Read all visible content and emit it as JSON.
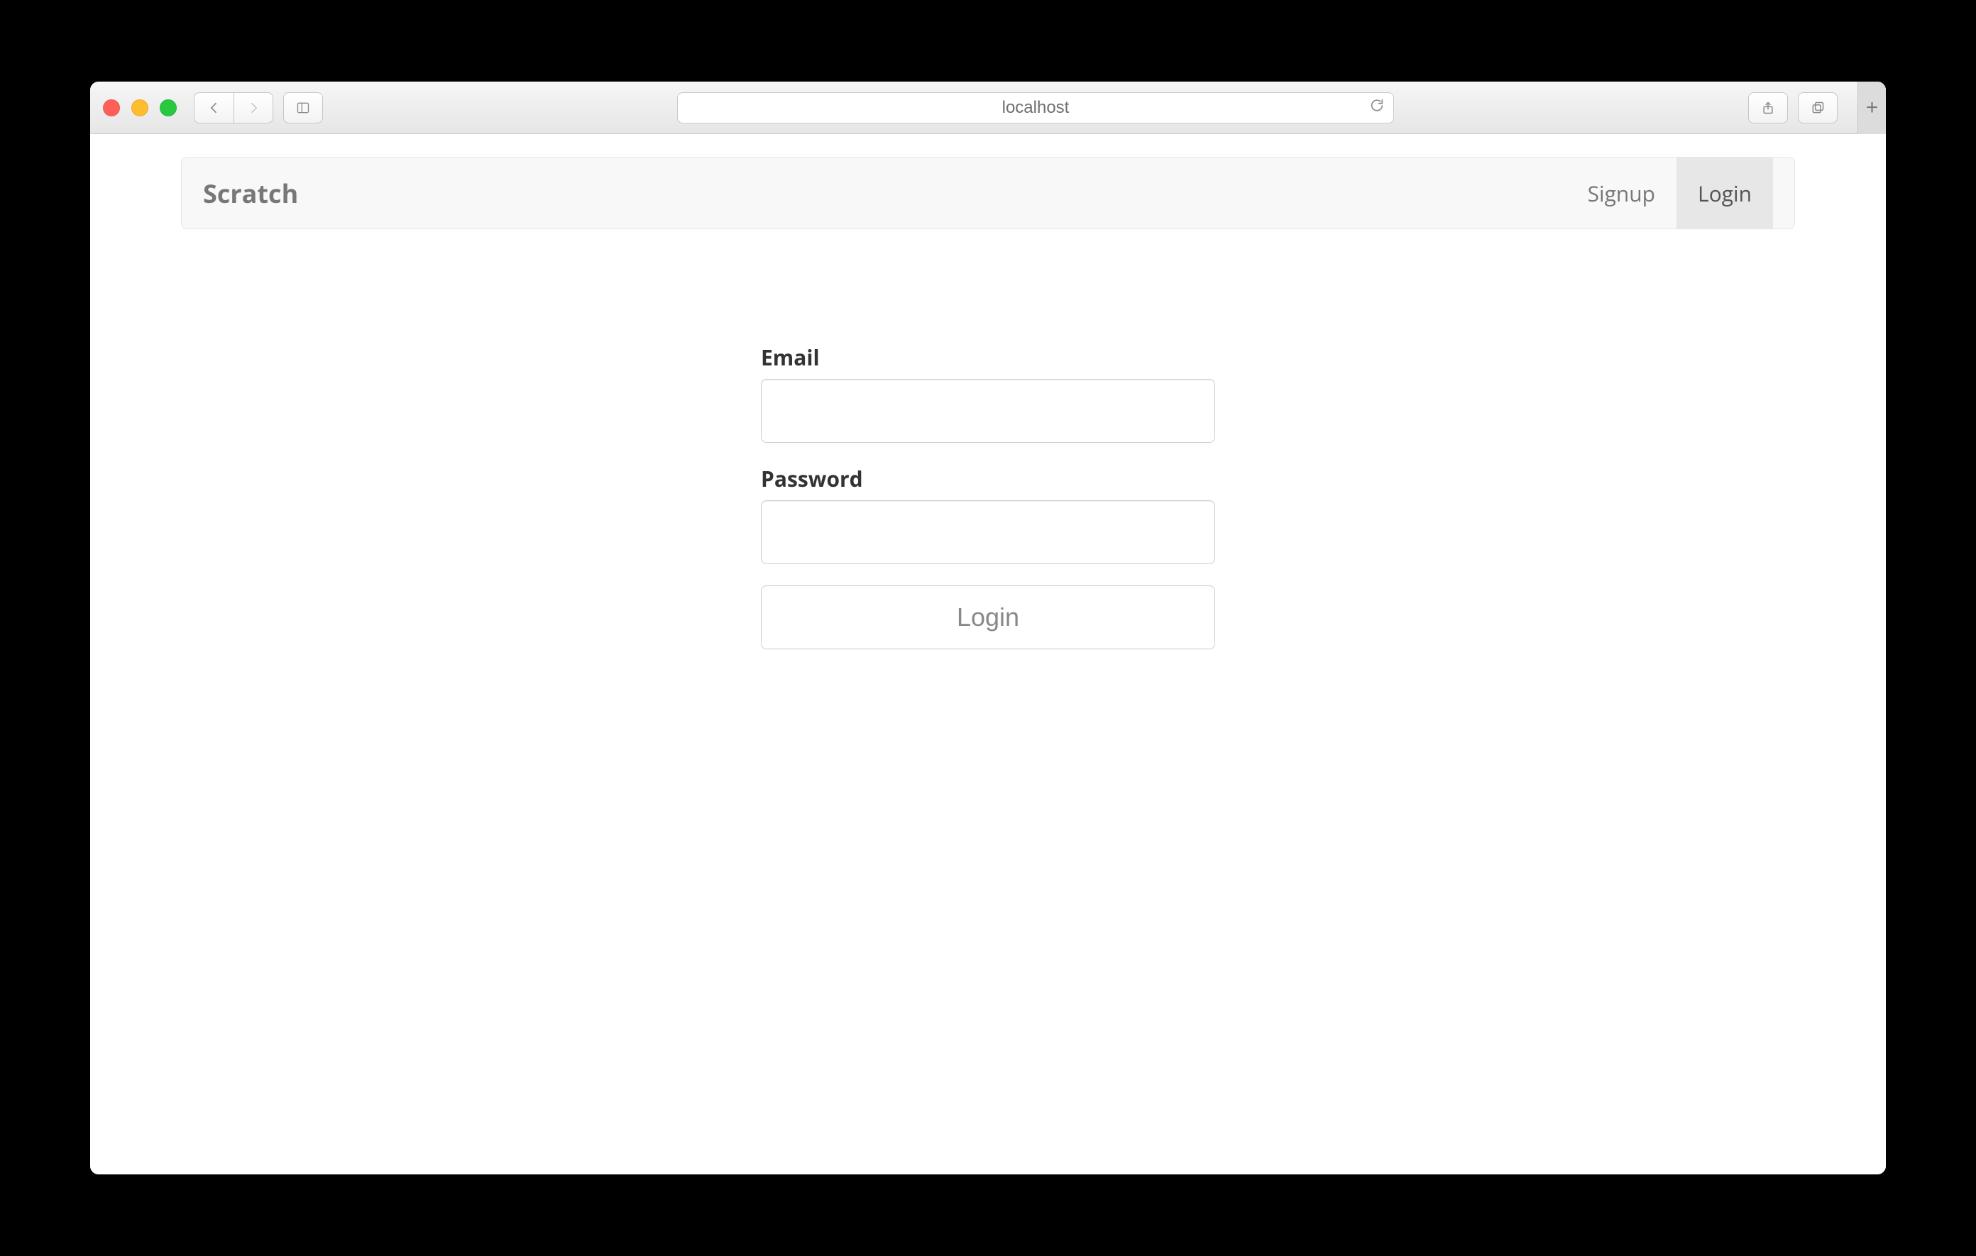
{
  "browser": {
    "address": "localhost"
  },
  "navbar": {
    "brand": "Scratch",
    "links": {
      "signup": "Signup",
      "login": "Login"
    },
    "active": "login"
  },
  "form": {
    "email": {
      "label": "Email",
      "value": ""
    },
    "password": {
      "label": "Password",
      "value": ""
    },
    "submit_label": "Login",
    "submit_enabled": false
  }
}
